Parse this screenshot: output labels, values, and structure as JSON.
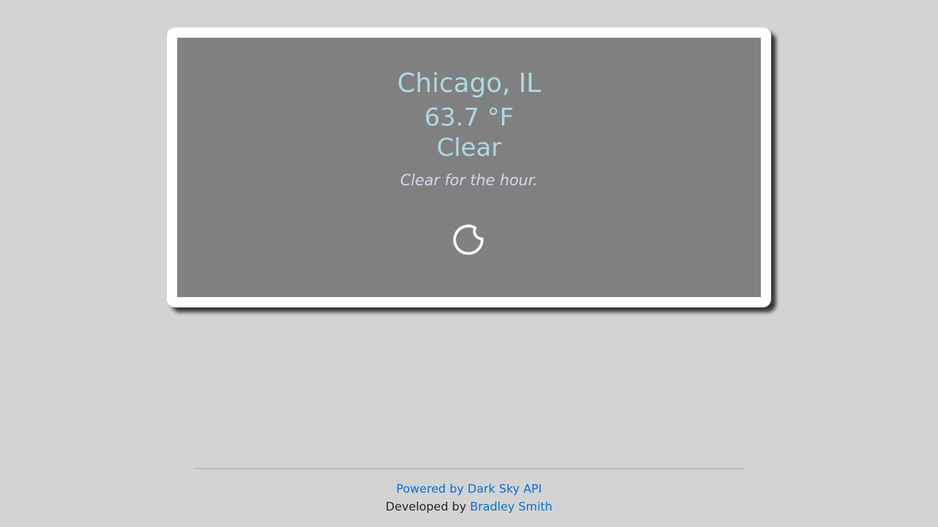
{
  "weather": {
    "location": "Chicago, IL",
    "temperature": "63.7 °F",
    "summary": "Clear",
    "minutely_summary": "Clear for the hour.",
    "icon": "clear-night-moon-icon"
  },
  "footer": {
    "powered_by_link": "Powered by Dark Sky API",
    "developed_by_prefix": "Developed by",
    "developer_link": "Bradley Smith"
  },
  "colors": {
    "background": "#d3d3d3",
    "card_border": "#ffffff",
    "card_fill": "#808080",
    "heading_text": "#add8e6",
    "subtitle_text": "#e0d0f0",
    "link": "#0a6ed1"
  }
}
